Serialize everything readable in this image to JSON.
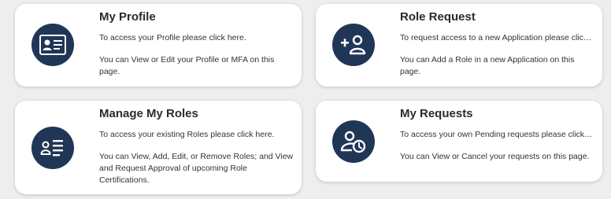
{
  "colors": {
    "background": "#eeeeee",
    "card": "#ffffff",
    "icon_circle": "#203656",
    "text": "#333333"
  },
  "cards": [
    {
      "title": "My Profile",
      "icon": "id-card-icon",
      "line1": "To access your Profile please click here.",
      "line2": "You can View or Edit your Profile or MFA on this page."
    },
    {
      "title": "Role Request",
      "icon": "add-user-icon",
      "line1": "To request access to a new Application please click here.",
      "line2": "You can Add a Role in a new Application on this page."
    },
    {
      "title": "Manage My Roles",
      "icon": "user-list-icon",
      "line1": "To access your existing Roles please click here.",
      "line2": "You can View, Add, Edit, or Remove Roles; and View and Request Approval of upcoming Role Certifications."
    },
    {
      "title": "My Requests",
      "icon": "user-clock-icon",
      "line1": "To access your own Pending requests please click here.",
      "line2": "You can View or Cancel your requests on this page."
    }
  ]
}
